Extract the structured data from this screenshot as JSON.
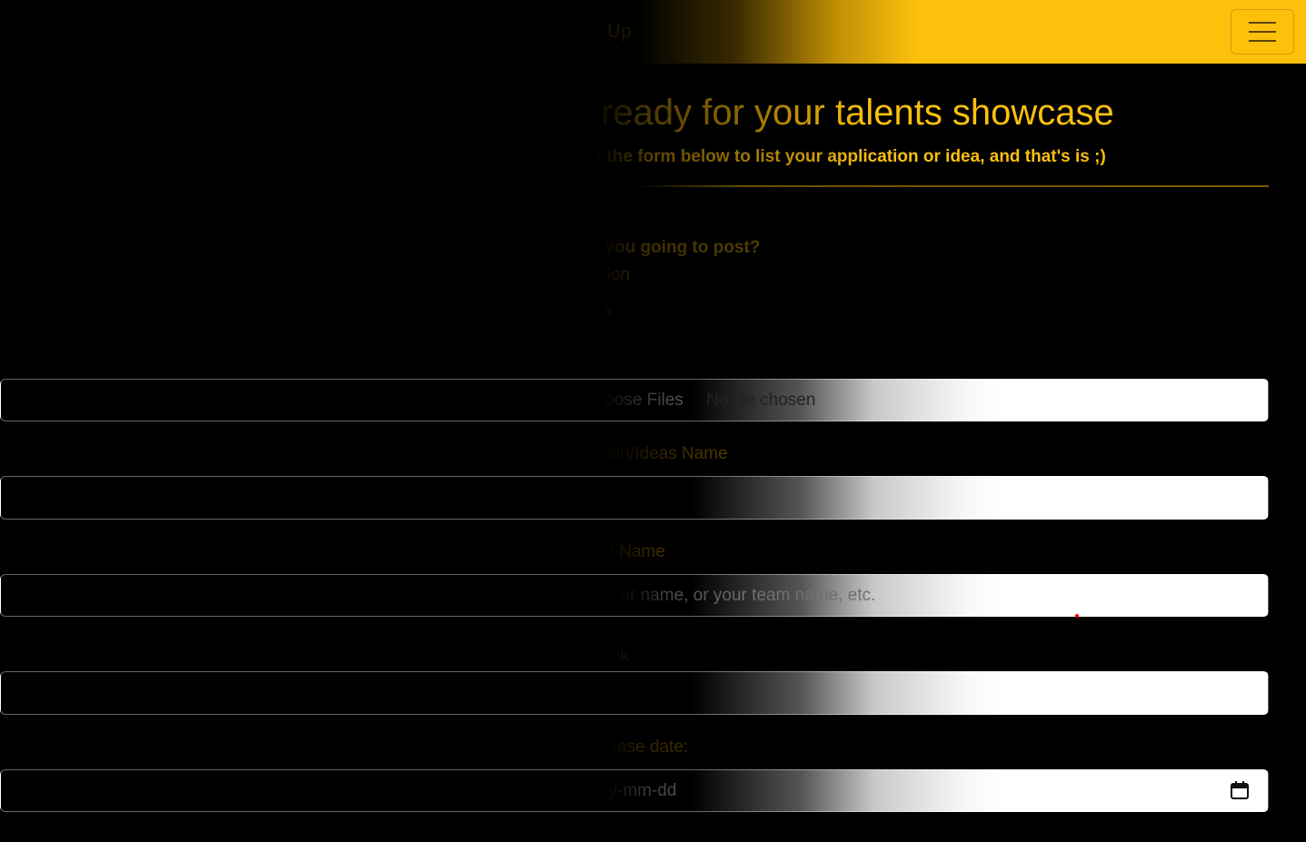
{
  "navbar": {
    "brand": "Up",
    "menu_toggle_icon": "hamburger-menu-icon",
    "accent_color": "#fdc10c"
  },
  "header": {
    "title": "Let's get ready for your talents showcase",
    "subtitle": "Fill out the form below to list your application or idea, and that's is ;)"
  },
  "form": {
    "post_type": {
      "question": "What are you going to post?",
      "option_1": "Application",
      "option_2": "Idea"
    },
    "files": {
      "button_label": "Choose Files",
      "status": "No file chosen"
    },
    "name": {
      "label": "Application/Ideas Name",
      "value": ""
    },
    "owner": {
      "label": "Owner Name",
      "placeholder": "Your name, or your team name, etc."
    },
    "link": {
      "label": "Link",
      "value": ""
    },
    "date": {
      "label": "Release date:",
      "placeholder": "yyyy-mm-dd",
      "icon": "calendar-icon"
    }
  }
}
